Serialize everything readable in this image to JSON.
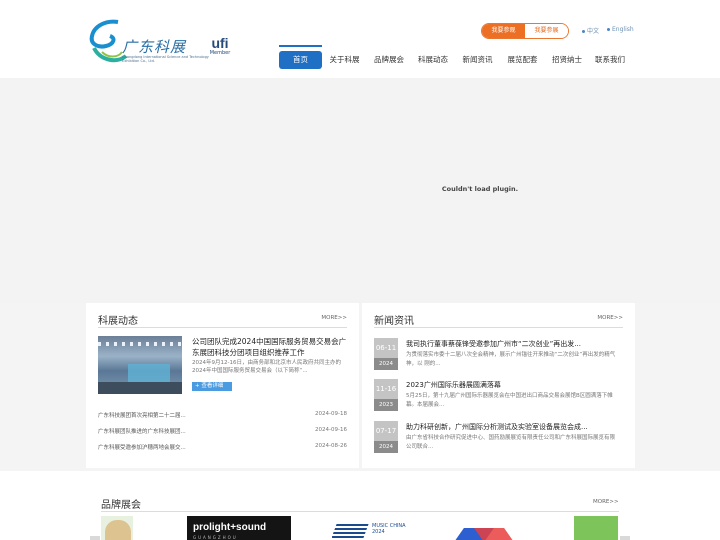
{
  "header": {
    "logo_cn": "广东科展",
    "logo_en": "Guangdong International Science and Technology Exhibition Co., Ltd.",
    "ufi_logo": "ufi",
    "ufi_member": "Member",
    "buttons": {
      "visit": "我要参观",
      "exhibit": "我要参展"
    },
    "lang": {
      "cn": "中文",
      "en": "English"
    },
    "nav": [
      {
        "label": "首页",
        "active": true
      },
      {
        "label": "关于科展"
      },
      {
        "label": "品牌展会"
      },
      {
        "label": "科展动态"
      },
      {
        "label": "新闻资讯"
      },
      {
        "label": "展览配套"
      },
      {
        "label": "招贤纳士"
      },
      {
        "label": "联系我们"
      }
    ]
  },
  "banner": {
    "plugin_message": "Couldn't load plugin."
  },
  "kezhan_news": {
    "title": "科展动态",
    "more": "MORE>>",
    "feature": {
      "title": "公司团队完成2024中国国际服务贸易交易会广东展团科技分团项目组织推荐工作",
      "desc": "2024年9月12-16日，由商务部和北京市人民政府共同主办的2024年中国国际服务贸易交易会（以下简称“...",
      "button": "+ 查看详细"
    },
    "items": [
      {
        "title": "广东科技展团首次亮相第二十二届...",
        "date": "2024-09-18"
      },
      {
        "title": "广东科展团队推进的广东科技展团...",
        "date": "2024-09-16"
      },
      {
        "title": "广东科展受邀参加沪穗两地会展交...",
        "date": "2024-08-26"
      }
    ]
  },
  "news_info": {
    "title": "新闻资讯",
    "more": "MORE>>",
    "items": [
      {
        "day": "06-11",
        "year": "2024",
        "title": "我司执行董事蔡葆锋受邀参加广州市“二次创业”再出发...",
        "desc": "为贯彻落实市委十二届八次全会精神，展示广州锚往开来推动“二次创业”再出发的精气神，以 刚的..."
      },
      {
        "day": "11-16",
        "year": "2023",
        "title": "2023广州国际乐器展圆满落幕",
        "desc": "5月25日，第十九届广州国际乐器展览会在中国进出口商品交易会展馆B区圆满落下帷幕。本届展会..."
      },
      {
        "day": "07-17",
        "year": "2024",
        "title": "助力科研创新，广州国际分析测试及实验室设备展览会成...",
        "desc": "由广东省科技合作研究促进中心、国药励展展览有限责任公司和广东科展国际展览有限公司联合..."
      }
    ]
  },
  "brands": {
    "title": "品牌展会",
    "more": "MORE>>",
    "logos": [
      "prolight+sound",
      "GUANGZHOU",
      "MUSIC CHINA 2024"
    ]
  }
}
